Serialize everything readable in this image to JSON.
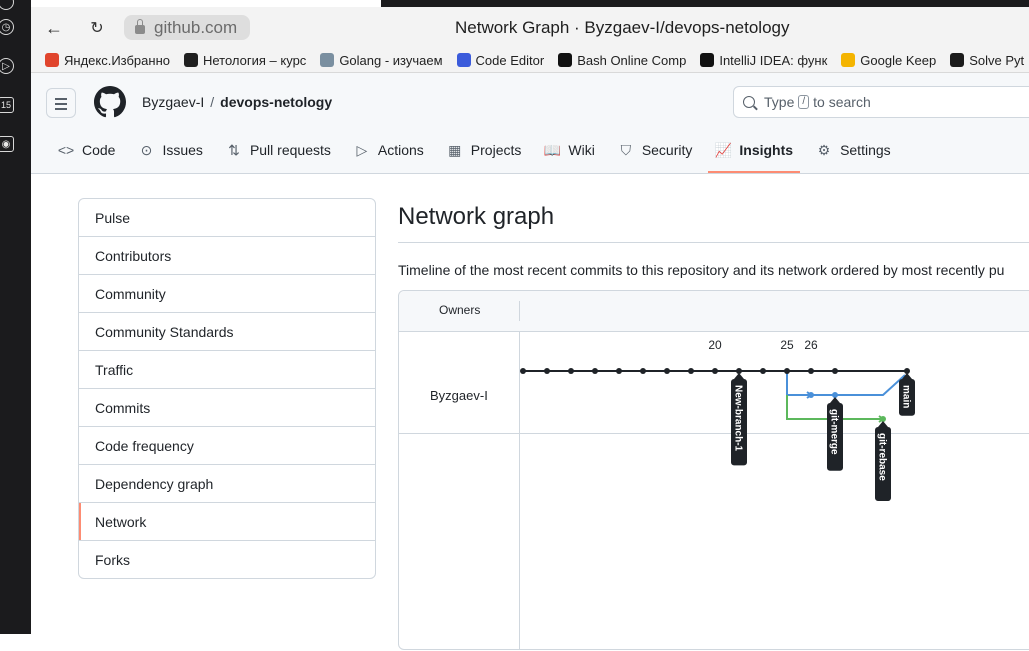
{
  "browser": {
    "url": "github.com",
    "title": "Network Graph · Byzgaev-I/devops-netology",
    "os_badge": "15"
  },
  "bookmarks": [
    {
      "label": "Яндекс.Избранно",
      "color": "#e0442c"
    },
    {
      "label": "Нетология – курс",
      "color": "#1f1f1f"
    },
    {
      "label": "Golang - изучаем",
      "color": "#7a8fa0"
    },
    {
      "label": "Code Editor",
      "color": "#3b5bdb"
    },
    {
      "label": "Bash Online Comp",
      "color": "#111111"
    },
    {
      "label": "IntelliJ IDEA: функ",
      "color": "#111111"
    },
    {
      "label": "Google Keep",
      "color": "#f4b400"
    },
    {
      "label": "Solve Pyt",
      "color": "#1a1a1a"
    }
  ],
  "header": {
    "owner": "Byzgaev-I",
    "separator": "/",
    "repo": "devops-netology",
    "search_text_1": "Type",
    "search_key": "/",
    "search_text_2": "to search"
  },
  "tabs": [
    {
      "label": "Code",
      "icon": "code-icon",
      "glyph": "<>"
    },
    {
      "label": "Issues",
      "icon": "issue-icon",
      "glyph": "⊙"
    },
    {
      "label": "Pull requests",
      "icon": "pull-request-icon",
      "glyph": "⇅"
    },
    {
      "label": "Actions",
      "icon": "play-icon",
      "glyph": "▷"
    },
    {
      "label": "Projects",
      "icon": "table-icon",
      "glyph": "▦"
    },
    {
      "label": "Wiki",
      "icon": "book-icon",
      "glyph": "📖"
    },
    {
      "label": "Security",
      "icon": "shield-icon",
      "glyph": "⛉"
    },
    {
      "label": "Insights",
      "icon": "graph-icon",
      "glyph": "📈",
      "active": true
    },
    {
      "label": "Settings",
      "icon": "gear-icon",
      "glyph": "⚙"
    }
  ],
  "sidebar": [
    "Pulse",
    "Contributors",
    "Community",
    "Community Standards",
    "Traffic",
    "Commits",
    "Code frequency",
    "Dependency graph",
    "Network",
    "Forks"
  ],
  "sidebar_selected": "Network",
  "main": {
    "title": "Network graph",
    "description": "Timeline of the most recent commits to this repository and its network ordered by most recently pu"
  },
  "graph": {
    "owners_header": "Owners",
    "owner": "Byzgaev-I",
    "dates": [
      "20",
      "25",
      "26"
    ],
    "branches": [
      "New-branch-1",
      "git-merge",
      "git-rebase",
      "main"
    ],
    "colors": {
      "main": "#1f2328",
      "merge": "#4a90d9",
      "rebase": "#5cb85c"
    }
  }
}
